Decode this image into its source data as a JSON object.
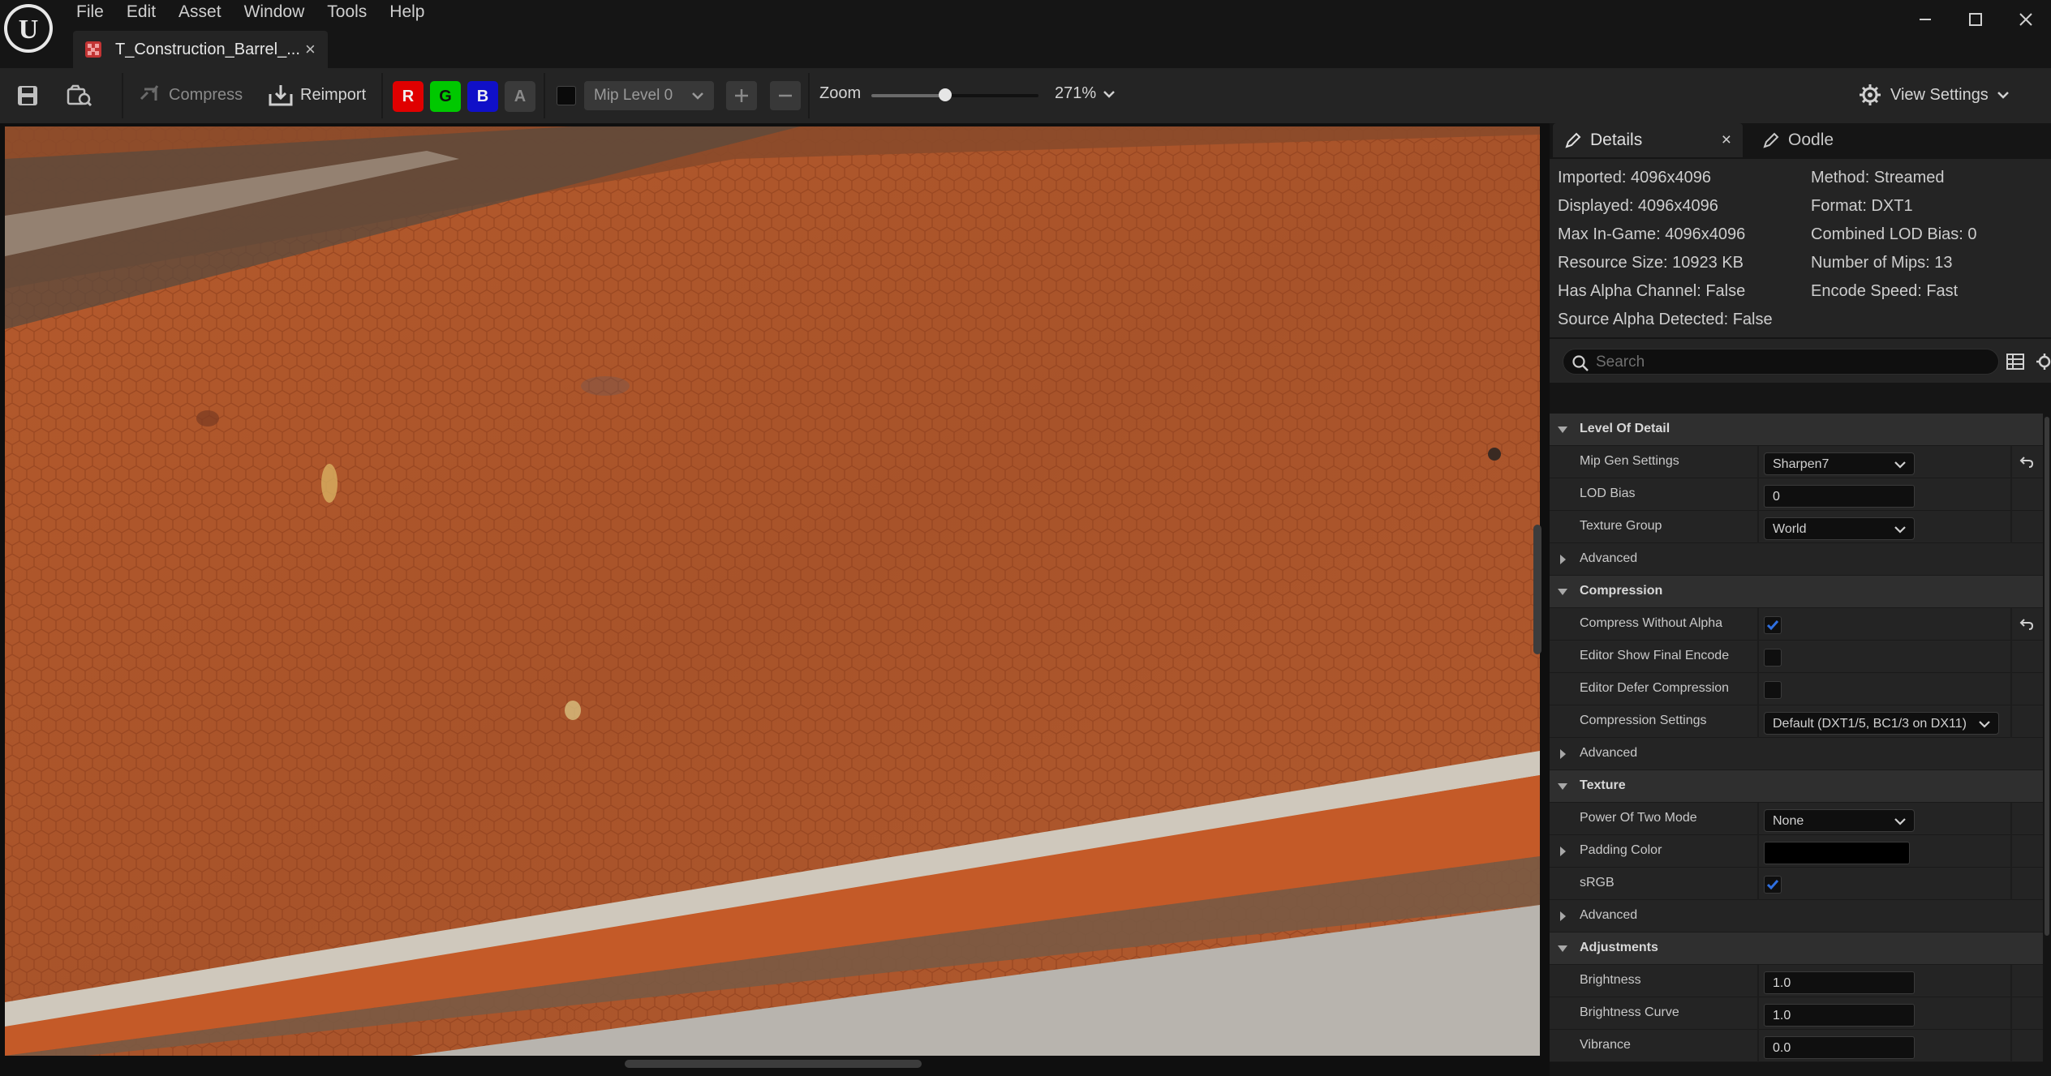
{
  "menu": [
    "File",
    "Edit",
    "Asset",
    "Window",
    "Tools",
    "Help"
  ],
  "document_tab": {
    "label": "T_Construction_Barrel_...",
    "close": "×"
  },
  "window_controls": {
    "minimize": "—",
    "maximize": "☐",
    "close": "✕"
  },
  "toolbar": {
    "compress_label": "Compress",
    "reimport_label": "Reimport",
    "channels": [
      {
        "label": "R",
        "color": "#e00000"
      },
      {
        "label": "G",
        "color": "#00c800"
      },
      {
        "label": "B",
        "color": "#1010c8"
      },
      {
        "label": "A",
        "color": "#3a3a3a"
      }
    ],
    "mip_level": "Mip Level 0",
    "zoom_label": "Zoom",
    "zoom_value": "271%",
    "zoom_slider_fraction": 0.44,
    "view_settings_label": "View Settings"
  },
  "panel": {
    "tabs": {
      "details": "Details",
      "details_close": "×",
      "oodle": "Oodle"
    },
    "info": {
      "imported": "Imported: 4096x4096",
      "displayed": "Displayed: 4096x4096",
      "max_in_game": "Max In-Game: 4096x4096",
      "resource_size": "Resource Size: 10923 KB",
      "has_alpha": "Has Alpha Channel: False",
      "source_alpha": "Source Alpha Detected: False",
      "method": "Method: Streamed",
      "format": "Format: DXT1",
      "lod_bias": "Combined LOD Bias: 0",
      "num_mips": "Number of Mips: 13",
      "encode_speed": "Encode Speed: Fast"
    },
    "search_placeholder": "Search",
    "properties": {
      "lod_category": "Level Of Detail",
      "mip_gen_label": "Mip Gen Settings",
      "mip_gen_value": "Sharpen7",
      "lod_bias_label": "LOD Bias",
      "lod_bias_value": "0",
      "texture_group_label": "Texture Group",
      "texture_group_value": "World",
      "advanced_1": "Advanced",
      "compression_category": "Compression",
      "compress_without_alpha_label": "Compress Without Alpha",
      "compress_without_alpha_checked": true,
      "editor_show_final_label": "Editor Show Final Encode",
      "editor_defer_label": "Editor Defer Compression",
      "compression_settings_label": "Compression Settings",
      "compression_settings_value": "Default (DXT1/5, BC1/3 on DX11)",
      "advanced_2": "Advanced",
      "texture_category": "Texture",
      "power_of_two_label": "Power Of Two Mode",
      "power_of_two_value": "None",
      "padding_color_label": "Padding Color",
      "padding_color_value": "#000000",
      "srgb_label": "sRGB",
      "srgb_checked": true,
      "advanced_3": "Advanced",
      "adjustments_category": "Adjustments",
      "brightness_label": "Brightness",
      "brightness_value": "1.0",
      "brightness_curve_label": "Brightness Curve",
      "brightness_curve_value": "1.0",
      "vibrance_label": "Vibrance",
      "vibrance_value": "0.0"
    }
  },
  "colors": {
    "accent_check": "#2f6fe0",
    "texture_rust": "#b0552a"
  }
}
